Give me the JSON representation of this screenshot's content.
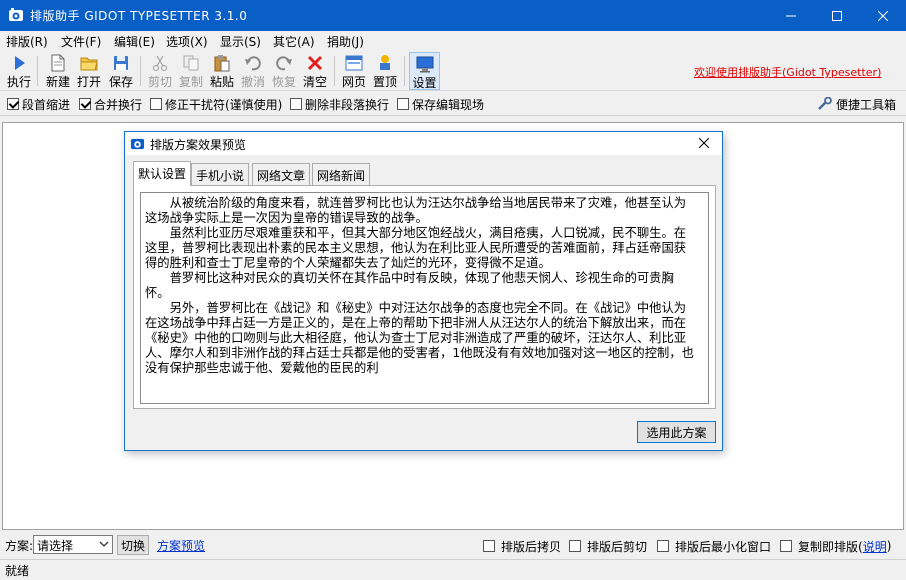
{
  "window": {
    "title": "排版助手 GIDOT TYPESETTER 3.1.0",
    "colors": {
      "titlebar": "#0a5fc7",
      "dialog_border": "#1a73d4",
      "link_red": "#e00000",
      "link_blue": "#0033cc"
    }
  },
  "menu": [
    "排版(R)",
    "文件(F)",
    "编辑(E)",
    "选项(X)",
    "显示(S)",
    "其它(A)",
    "捐助(J)"
  ],
  "toolbar": {
    "run": "执行",
    "new": "新建",
    "open": "打开",
    "save": "保存",
    "cut": "剪切",
    "copy": "复制",
    "paste": "粘贴",
    "undo": "撤消",
    "redo": "恢复",
    "clear": "清空",
    "web": "网页",
    "top": "置顶",
    "settings": "设置",
    "welcome": "欢迎使用排版助手(Gidot Typesetter)"
  },
  "options": {
    "indent": {
      "label": "段首缩进",
      "checked": true
    },
    "merge": {
      "label": "合并换行",
      "checked": true
    },
    "fix": {
      "label": "修正干扰符(谨慎使用)",
      "checked": false
    },
    "remove_breaks": {
      "label": "删除非段落换行",
      "checked": false
    },
    "keep_scene": {
      "label": "保存编辑现场",
      "checked": false
    },
    "toolbox": "便捷工具箱"
  },
  "dialog": {
    "title": "排版方案效果预览",
    "tabs": [
      "默认设置",
      "手机小说",
      "网络文章",
      "网络新闻"
    ],
    "active_tab": 0,
    "paragraphs": [
      "从被统治阶级的角度来看，就连普罗柯比也认为汪达尔战争给当地居民带来了灾难，他甚至认为这场战争实际上是一次因为皇帝的错误导致的战争。",
      "虽然利比亚历尽艰难重获和平，但其大部分地区饱经战火，满目疮痍，人口锐减，民不聊生。在这里，普罗柯比表现出朴素的民本主义思想，他认为在利比亚人民所遭受的苦难面前，拜占廷帝国获得的胜利和查士丁尼皇帝的个人荣耀都失去了灿烂的光环，变得微不足道。",
      "普罗柯比这种对民众的真切关怀在其作品中时有反映，体现了他悲天悯人、珍视生命的可贵胸怀。",
      "另外，普罗柯比在《战记》和《秘史》中对汪达尔战争的态度也完全不同。在《战记》中他认为在这场战争中拜占廷一方是正义的，是在上帝的帮助下把非洲人从汪达尔人的统治下解放出来，而在《秘史》中他的口吻则与此大相径庭，他认为查士丁尼对非洲造成了严重的破坏，汪达尔人、利比亚人、摩尔人和到非洲作战的拜占廷士兵都是他的受害者，1他既没有有效地加强对这一地区的控制，也没有保护那些忠诚于他、爱戴他的臣民的利"
    ],
    "use_button": "选用此方案"
  },
  "bottom": {
    "scheme_label": "方案:",
    "scheme_value": "请选择",
    "switch": "切换",
    "preview": "方案预览",
    "after_copy": "排版后拷贝",
    "after_cut": "排版后剪切",
    "after_minimize": "排版后最小化窗口",
    "copy_then_format": "复制即排版(",
    "help": "说明",
    "help_close": ")"
  },
  "status": "就绪"
}
